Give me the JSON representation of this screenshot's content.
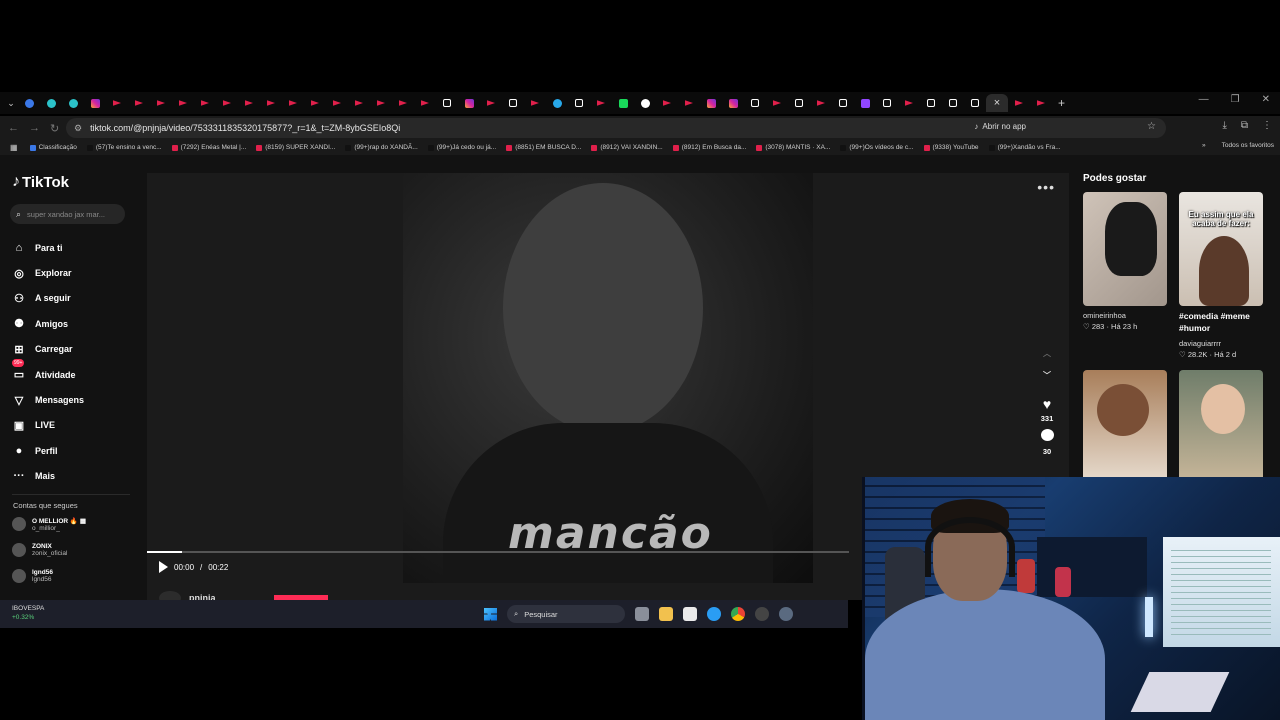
{
  "browser": {
    "url": "tiktok.com/@pnjnja/video/7533311835320175877?_r=1&_t=ZM-8ybGSEIo8Qi",
    "open_in_app": "Abrir no app",
    "bookmarks": [
      {
        "label": "Classificação",
        "color": "#3b78e7"
      },
      {
        "label": "(57)Te ensino a venc...",
        "color": "#111111"
      },
      {
        "label": "(7292) Enéas Metal |...",
        "color": "#e0204b"
      },
      {
        "label": "(8159) SUPER XANDI...",
        "color": "#e0204b"
      },
      {
        "label": "(99+)rap do XANDÃ...",
        "color": "#111111"
      },
      {
        "label": "(99+)Já cedo ou já...",
        "color": "#111111"
      },
      {
        "label": "(8851) EM BUSCA D...",
        "color": "#e0204b"
      },
      {
        "label": "(8912) VAI XANDIN...",
        "color": "#e0204b"
      },
      {
        "label": "(8912) Em Busca da...",
        "color": "#e0204b"
      },
      {
        "label": "(3078) MANTIS · XA...",
        "color": "#e0204b"
      },
      {
        "label": "(99+)Os vídeos de c...",
        "color": "#111111"
      },
      {
        "label": "(9338) YouTube",
        "color": "#e0204b"
      },
      {
        "label": "(99+)Xandão vs Fra...",
        "color": "#111111"
      }
    ],
    "bookmarks_more": "»",
    "all_favorites": "Todos os favoritos",
    "tab_favicons": [
      "blue",
      "teal",
      "teal",
      "ig",
      "yt",
      "yt",
      "yt",
      "yt",
      "yt",
      "yt",
      "yt",
      "yt",
      "yt",
      "yt",
      "yt",
      "yt",
      "yt",
      "yt",
      "yt",
      "tk",
      "ig",
      "yt",
      "tk",
      "yt",
      "tg",
      "tk",
      "yt",
      "green",
      "g",
      "yt",
      "yt",
      "ig",
      "ig",
      "tk",
      "yt",
      "tk",
      "yt",
      "tk",
      "purple",
      "tk",
      "yt",
      "tk",
      "tk",
      "tk",
      "yt",
      "yt"
    ],
    "active_tab_close": "×",
    "new_tab": "+"
  },
  "tiktok": {
    "brand": "TikTok",
    "search_placeholder": "super xandao jax mar...",
    "nav": [
      {
        "label": "Para ti",
        "icon": "home-icon",
        "glyph": "⌂"
      },
      {
        "label": "Explorar",
        "icon": "compass-icon",
        "glyph": "◎"
      },
      {
        "label": "A seguir",
        "icon": "following-icon",
        "glyph": "⚇"
      },
      {
        "label": "Amigos",
        "icon": "friends-icon",
        "glyph": "⚉"
      },
      {
        "label": "Carregar",
        "icon": "upload-icon",
        "glyph": "⊞"
      },
      {
        "label": "Atividade",
        "icon": "activity-icon",
        "glyph": "▭"
      },
      {
        "label": "Mensagens",
        "icon": "messages-icon",
        "glyph": "▽"
      },
      {
        "label": "LIVE",
        "icon": "live-icon",
        "glyph": "▣"
      },
      {
        "label": "Perfil",
        "icon": "profile-icon",
        "glyph": "●"
      },
      {
        "label": "Mais",
        "icon": "more-icon",
        "glyph": "···"
      }
    ],
    "activity_badge": "99+",
    "following_header": "Contas que segues",
    "following": [
      {
        "name": "O MELLIOR 🔥 ▦",
        "handle": "o_millior_"
      },
      {
        "name": "ZONIX",
        "handle": "zonix_oficial"
      },
      {
        "name": "lgnd56",
        "handle": "lgnd56"
      }
    ],
    "video": {
      "shirt_text": "mancão",
      "time_current": "00:00",
      "time_total": "00:22",
      "progress": 0.05,
      "author": "pnjnja",
      "likes": "331",
      "comments": "30"
    },
    "suggest": {
      "title": "Podes gostar",
      "cards": [
        {
          "name": "omineirinhoa",
          "title": "",
          "likes": "283",
          "age": "Há 23 h"
        },
        {
          "name": "daviaguiarrrr",
          "title": "#comedia #meme #humor",
          "likes": "28.2K",
          "age": "Há 2 d",
          "caption": "Eu assim que ela acaba de fazer:"
        },
        {
          "name": "",
          "title": "",
          "likes": "",
          "age": ""
        },
        {
          "name": "",
          "title": "",
          "likes": "",
          "age": ""
        }
      ]
    }
  },
  "taskbar": {
    "ticker": "IBOVESPA",
    "change": "+0.32%",
    "search_label": "Pesquisar"
  }
}
